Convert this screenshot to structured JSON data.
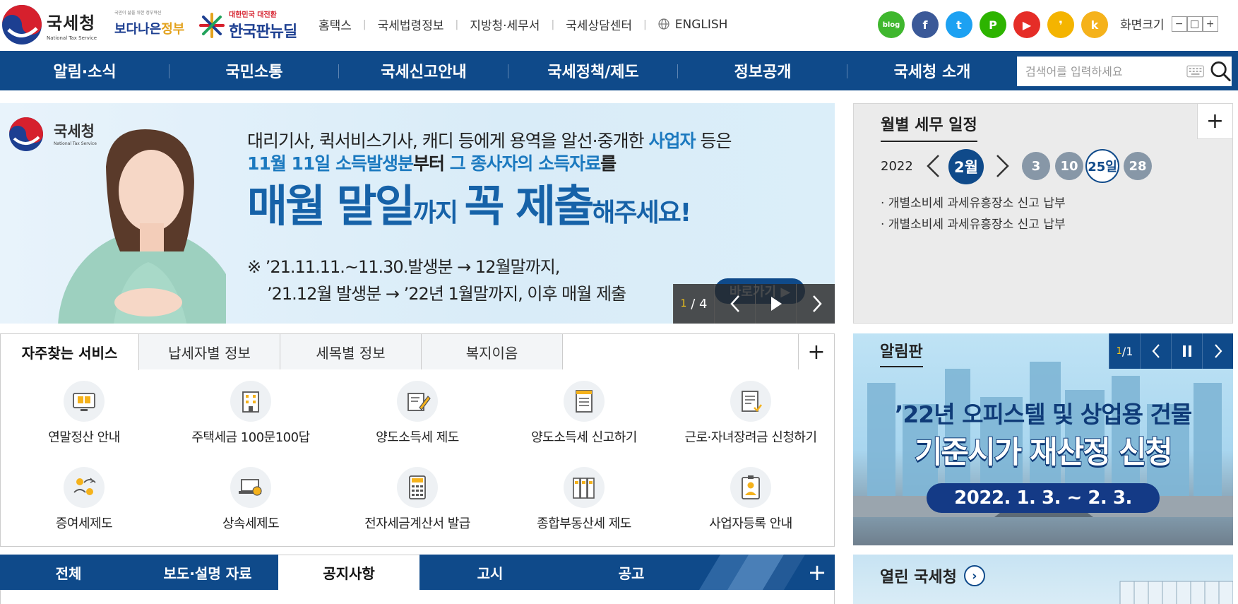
{
  "header": {
    "logo_kr": "국세청",
    "logo_en": "National Tax Service",
    "gov_small": "국민이 삶을 위한 정부혁신",
    "gov_big_a": "보다나은",
    "gov_big_b": "정부",
    "ndeal_small": "대한민국 대전환",
    "ndeal_big": "한국판뉴딜",
    "nav": [
      "홈택스",
      "국세법령정보",
      "지방청·세무서",
      "국세상담센터",
      "ENGLISH"
    ],
    "sns": [
      {
        "name": "blog",
        "label": "blog",
        "color": "#3fb72e"
      },
      {
        "name": "facebook",
        "label": "f",
        "color": "#3b5998"
      },
      {
        "name": "twitter",
        "label": "t",
        "color": "#1da1f2"
      },
      {
        "name": "post",
        "label": "P",
        "color": "#2db400"
      },
      {
        "name": "youtube",
        "label": "▶",
        "color": "#e52d27"
      },
      {
        "name": "kakao-story",
        "label": "❜",
        "color": "#f4b400"
      },
      {
        "name": "kakao-channel",
        "label": "k",
        "color": "#f5b21b"
      }
    ],
    "font_size_label": "화면크기",
    "font_size_buttons": [
      "−",
      "□",
      "+"
    ]
  },
  "main_nav": {
    "items": [
      "알림·소식",
      "국민소통",
      "국세신고안내",
      "국세정책/제도",
      "정보공개",
      "국세청 소개"
    ],
    "search_placeholder": "검색어를 입력하세요"
  },
  "hero": {
    "logo_kr": "국세청",
    "logo_en": "National Tax Service",
    "line1_a": "대리기사, 퀵서비스기사, 캐디 등에게 용역을 알선·중개한 ",
    "line1_hl": "사업자",
    "line1_b": " 등은",
    "line2_hl1": "11월 11일 소득발생분",
    "line2_a": "부터 ",
    "line2_hl2": "그 종사자의 소득자료",
    "line2_b": "를",
    "big_a": "매월 말일",
    "big_sm1": "까지 ",
    "big_b": "꼭 제출",
    "big_sm2": "해주세요!",
    "note1": "※ ’21.11.11.~11.30.발생분 → 12월말까지,",
    "note2": "’21.12월 발생분 → ’22년 1월말까지, 이후 매월 제출",
    "goto_label": "바로가기 ▶",
    "counter_current": "1",
    "counter_total": "/ 4"
  },
  "schedule": {
    "title": "월별 세무 일정",
    "year": "2022",
    "month": "2월",
    "days": [
      "3",
      "10",
      "25일",
      "28"
    ],
    "selected_day_index": 2,
    "events": [
      "· 개별소비세 과세유흥장소 신고 납부",
      "· 개별소비세 과세유흥장소 신고 납부"
    ]
  },
  "services": {
    "tabs": [
      "자주찾는 서비스",
      "납세자별 정보",
      "세목별 정보",
      "복지이음"
    ],
    "items": [
      {
        "label": "연말정산 안내",
        "icon": "book-monitor-icon"
      },
      {
        "label": "주택세금 100문100답",
        "icon": "building-icon"
      },
      {
        "label": "양도소득세 제도",
        "icon": "pen-document-icon"
      },
      {
        "label": "양도소득세 신고하기",
        "icon": "form-icon"
      },
      {
        "label": "근로·자녀장려금 신청하기",
        "icon": "apply-document-icon"
      },
      {
        "label": "증여세제도",
        "icon": "people-exchange-icon"
      },
      {
        "label": "상속세제도",
        "icon": "laptop-coin-icon"
      },
      {
        "label": "전자세금계산서 발급",
        "icon": "calculator-icon"
      },
      {
        "label": "종합부동산세 제도",
        "icon": "binders-icon"
      },
      {
        "label": "사업자등록 안내",
        "icon": "id-card-icon"
      }
    ]
  },
  "board": {
    "title": "알림판",
    "counter_current": "1",
    "counter_total": "/1",
    "headline1": "’22년 오피스텔 및 상업용 건물",
    "headline2": "기준시가 재산정 신청",
    "headline3": "2022. 1. 3. ~ 2. 3."
  },
  "bottom_tabs": {
    "items": [
      "전체",
      "보도·설명 자료",
      "공지사항",
      "고시",
      "공고"
    ],
    "active_index": 2
  },
  "open_nts": {
    "title": "열린 국세청"
  },
  "colors": {
    "brand_blue": "#0f4a8a",
    "accent_light_blue": "#1b79bf"
  }
}
